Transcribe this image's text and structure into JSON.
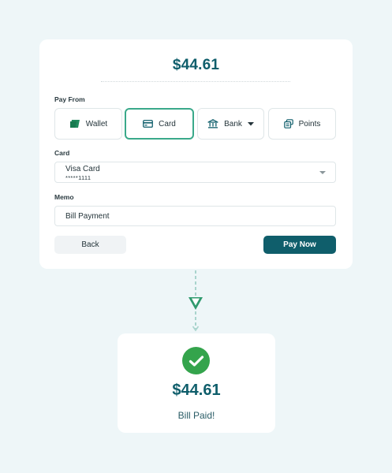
{
  "payment": {
    "amount": "$44.61",
    "pay_from_label": "Pay From",
    "methods": [
      {
        "label": "Wallet",
        "icon": "wallet-icon",
        "selected": false
      },
      {
        "label": "Card",
        "icon": "credit-card-icon",
        "selected": true
      },
      {
        "label": "Bank",
        "icon": "bank-icon",
        "selected": false,
        "has_dropdown": true
      },
      {
        "label": "Points",
        "icon": "points-coins-icon",
        "selected": false
      }
    ],
    "card_label": "Card",
    "card_select": {
      "name": "Visa Card",
      "number": "*****1111"
    },
    "memo_label": "Memo",
    "memo_value": "Bill Payment",
    "back_label": "Back",
    "pay_label": "Pay Now"
  },
  "result": {
    "amount": "$44.61",
    "message": "Bill Paid!"
  },
  "colors": {
    "background": "#eef6f8",
    "primary": "#0f5e6b",
    "selected_border": "#3aa98a",
    "success": "#34a44c",
    "connector": "#a9d4cd"
  }
}
